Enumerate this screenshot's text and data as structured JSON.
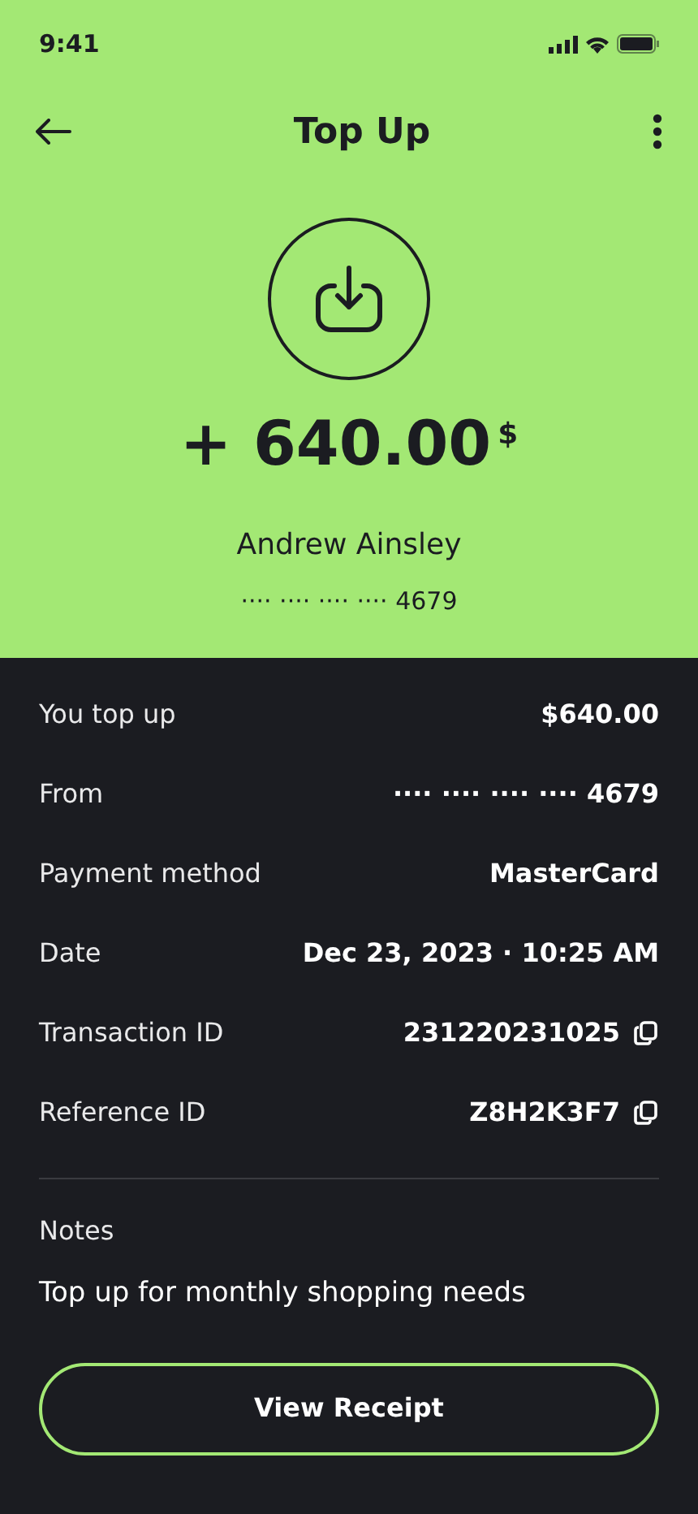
{
  "status_bar": {
    "time": "9:41"
  },
  "header": {
    "title": "Top Up"
  },
  "summary": {
    "amount": "+ 640.00",
    "currency": "$",
    "name": "Andrew Ainsley",
    "card": "···· ···· ···· ···· 4679"
  },
  "details": [
    {
      "label": "You top up",
      "value": "$640.00",
      "kind": "plain"
    },
    {
      "label": "From",
      "value": "···· ···· ···· ···· 4679",
      "kind": "plain"
    },
    {
      "label": "Payment method",
      "value": "MasterCard",
      "kind": "plain"
    },
    {
      "label": "Date",
      "value": "Dec 23, 2023 · 10:25 AM",
      "kind": "plain"
    },
    {
      "label": "Transaction ID",
      "value": "231220231025",
      "kind": "copy"
    },
    {
      "label": "Reference ID",
      "value": "Z8H2K3F7",
      "kind": "copy"
    }
  ],
  "notes": {
    "label": "Notes",
    "text": "Top up for monthly shopping needs"
  },
  "button": "View Receipt"
}
